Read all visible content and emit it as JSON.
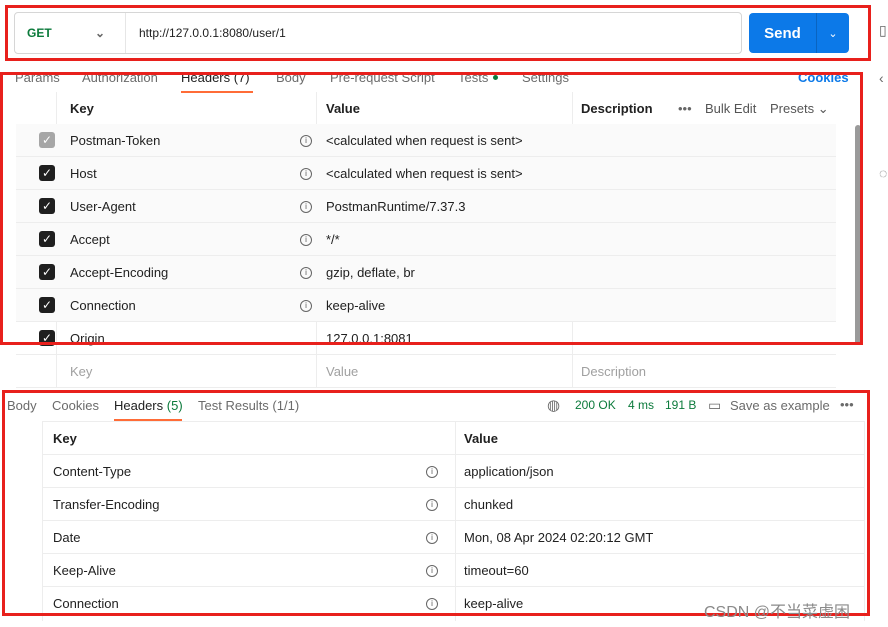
{
  "request": {
    "method": "GET",
    "url": "http://127.0.0.1:8080/user/1",
    "send_label": "Send"
  },
  "request_tabs": [
    {
      "label": "Params"
    },
    {
      "label": "Authorization"
    },
    {
      "label": "Headers (7)"
    },
    {
      "label": "Body"
    },
    {
      "label": "Pre-request Script"
    },
    {
      "label": "Tests"
    },
    {
      "label": "Settings"
    }
  ],
  "cookies_label": "Cookies",
  "req_headers": {
    "columns": {
      "key": "Key",
      "value": "Value",
      "description": "Description"
    },
    "bulk_edit": "Bulk Edit",
    "presets": "Presets",
    "rows": [
      {
        "key": "Postman-Token",
        "value": "<calculated when request is sent>",
        "auto": true
      },
      {
        "key": "Host",
        "value": "<calculated when request is sent>"
      },
      {
        "key": "User-Agent",
        "value": "PostmanRuntime/7.37.3"
      },
      {
        "key": "Accept",
        "value": "*/*"
      },
      {
        "key": "Accept-Encoding",
        "value": "gzip, deflate, br"
      },
      {
        "key": "Connection",
        "value": "keep-alive"
      },
      {
        "key": "Origin",
        "value": "127.0.0.1:8081"
      }
    ],
    "placeholders": {
      "key": "Key",
      "value": "Value",
      "description": "Description"
    }
  },
  "response_tabs": [
    {
      "label": "Body"
    },
    {
      "label": "Cookies"
    },
    {
      "label": "Headers",
      "count": "(5)"
    },
    {
      "label": "Test Results (1/1)"
    }
  ],
  "response_status": {
    "status": "200 OK",
    "time": "4 ms",
    "size": "191 B",
    "save_label": "Save as example"
  },
  "res_headers": {
    "columns": {
      "key": "Key",
      "value": "Value"
    },
    "rows": [
      {
        "key": "Content-Type",
        "value": "application/json"
      },
      {
        "key": "Transfer-Encoding",
        "value": "chunked"
      },
      {
        "key": "Date",
        "value": "Mon, 08 Apr 2024 02:20:12 GMT"
      },
      {
        "key": "Keep-Alive",
        "value": "timeout=60"
      },
      {
        "key": "Connection",
        "value": "keep-alive"
      }
    ]
  },
  "watermark": "CSDN @不当菜虚困",
  "colors": {
    "accent": "#0c79e8",
    "active_tab": "#ff6c37",
    "success": "#0b7a3b",
    "highlight_box": "#e8201c"
  }
}
